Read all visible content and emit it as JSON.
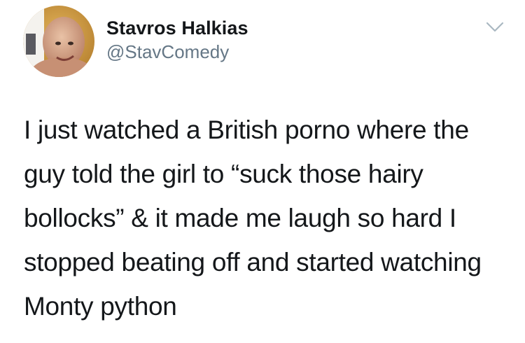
{
  "tweet": {
    "author": {
      "display_name": "Stavros Halkias",
      "handle": "@StavComedy",
      "avatar_icon": "profile-photo"
    },
    "menu_icon": "chevron-down-icon",
    "text": "I just watched a British porno where the guy told the girl to “suck those hairy bollocks” & it made me laugh so hard I stopped beating off and started watching Monty python"
  },
  "colors": {
    "text_primary": "#14171a",
    "text_secondary": "#657786",
    "caret": "#aab8c2"
  }
}
